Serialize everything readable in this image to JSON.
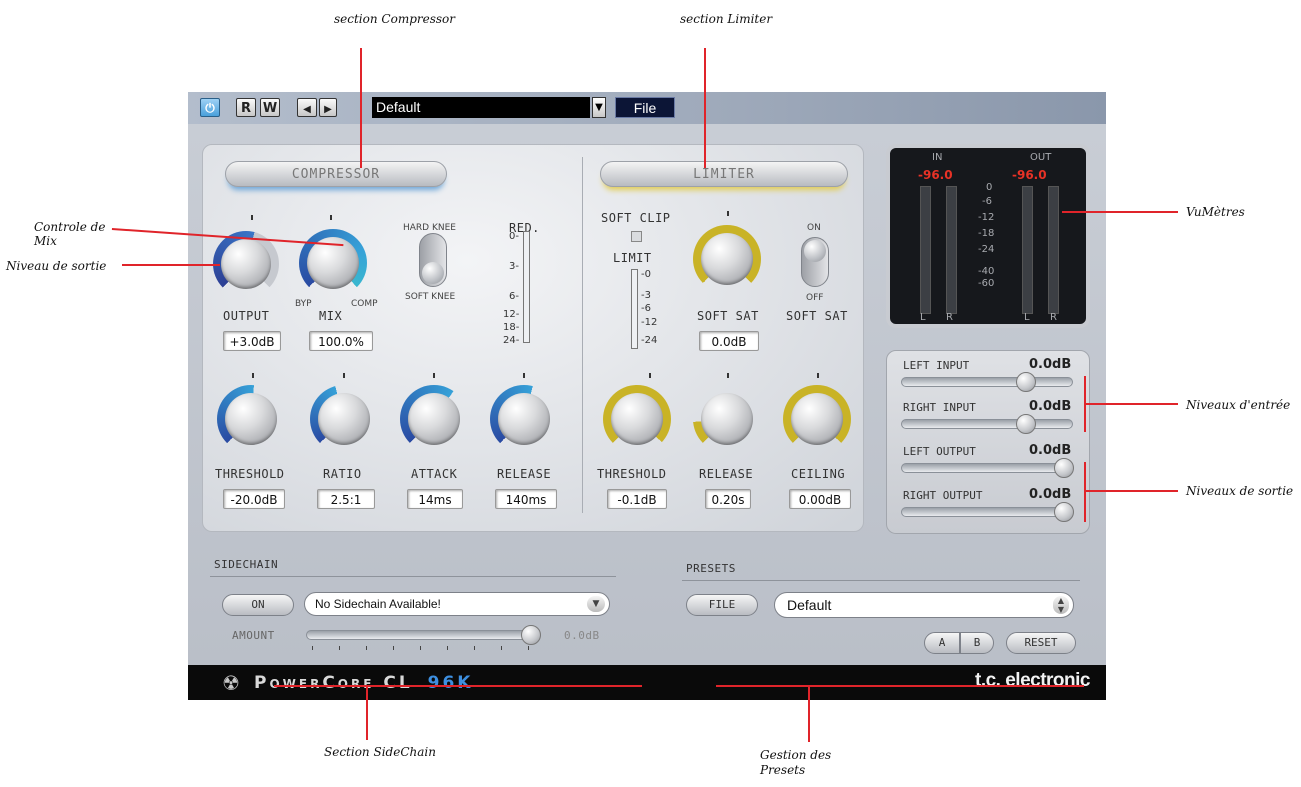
{
  "annotations": {
    "section_compressor": "section Compressor",
    "section_limiter": "section Limiter",
    "controle_mix_1": "Controle de",
    "controle_mix_2": "Mix",
    "niveau_sortie": "Niveau de sortie",
    "vumetres": "VuMètres",
    "niveaux_entree": "Niveaux d'entrée",
    "niveaux_sortie": "Niveaux de sortie",
    "section_sidechain": "Section SideChain",
    "gestion_presets_1": "Gestion   des",
    "gestion_presets_2": "Presets"
  },
  "toolbar": {
    "power_icon": "power-icon",
    "r_label": "R",
    "w_label": "W",
    "prev_icon": "arrow-left-icon",
    "next_icon": "arrow-right-icon",
    "preset_value": "Default",
    "file_label": "File"
  },
  "compressor": {
    "title": "COMPRESSOR",
    "output_label": "OUTPUT",
    "output_value": "+3.0dB",
    "mix_label": "MIX",
    "mix_bypass": "BYP",
    "mix_comp": "COMP",
    "mix_value": "100.0%",
    "hard_knee": "HARD KNEE",
    "soft_knee": "SOFT KNEE",
    "red_label": "RED.",
    "red_scale": [
      "0-",
      "3-",
      "6-",
      "12-",
      "18-",
      "24-"
    ],
    "threshold_label": "THRESHOLD",
    "threshold_value": "-20.0dB",
    "ratio_label": "RATIO",
    "ratio_value": "2.5:1",
    "attack_label": "ATTACK",
    "attack_value": "14ms",
    "release_label": "RELEASE",
    "release_value": "140ms"
  },
  "limiter": {
    "title": "LIMITER",
    "soft_clip": "SOFT CLIP",
    "limit_label": "LIMIT",
    "limit_scale": [
      "-0",
      "-3",
      "-6",
      "-12",
      "-24"
    ],
    "soft_sat_label": "SOFT SAT",
    "soft_sat_value": "0.0dB",
    "switch_on": "ON",
    "switch_off": "OFF",
    "switch_label": "SOFT SAT",
    "threshold_label": "THRESHOLD",
    "threshold_value": "-0.1dB",
    "release_label": "RELEASE",
    "release_value": "0.20s",
    "ceiling_label": "CEILING",
    "ceiling_value": "0.00dB"
  },
  "vu": {
    "in_label": "IN",
    "out_label": "OUT",
    "in_peak": "-96.0",
    "out_peak": "-96.0",
    "scale": [
      "0",
      "-6",
      "-12",
      "-18",
      "-24",
      "-40",
      "-60"
    ],
    "l": "L",
    "r": "R"
  },
  "levels": {
    "left_input_label": "LEFT INPUT",
    "left_input_value": "0.0dB",
    "left_input_level": 0.75,
    "right_input_label": "RIGHT INPUT",
    "right_input_value": "0.0dB",
    "right_input_level": 0.75,
    "left_output_label": "LEFT OUTPUT",
    "left_output_value": "0.0dB",
    "left_output_level": 1.0,
    "right_output_label": "RIGHT OUTPUT",
    "right_output_value": "0.0dB",
    "right_output_level": 1.0
  },
  "sidechain": {
    "title": "SIDECHAIN",
    "on_label": "ON",
    "select_value": "No Sidechain Available!",
    "amount_label": "AMOUNT",
    "amount_value": "0.0dB",
    "amount_level": 1.0
  },
  "presets": {
    "title": "PRESETS",
    "file_label": "FILE",
    "preset_value": "Default",
    "a_label": "A",
    "b_label": "B",
    "reset_label": "RESET"
  },
  "footer": {
    "brand_left": "PowerCore CL",
    "brand_left_suffix": "96K",
    "brand_right": "t.c. electronic"
  },
  "colors": {
    "accent_blue": "#2c7dc0",
    "accent_yellow": "#c9b326",
    "annotation_line": "#e0242a",
    "vu_peak": "#e83226"
  }
}
